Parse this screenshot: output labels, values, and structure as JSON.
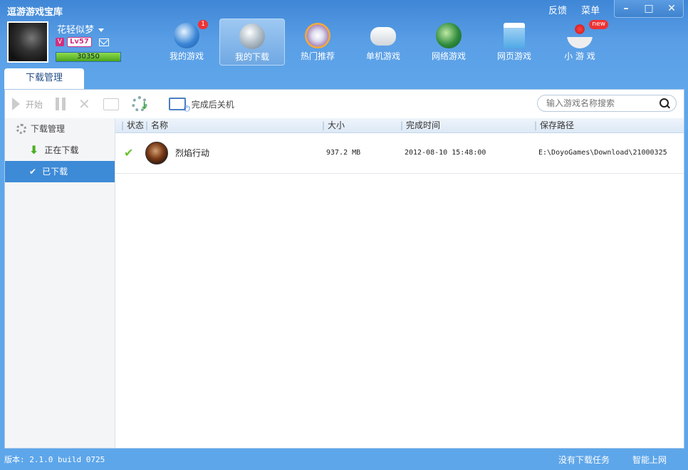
{
  "app": {
    "title": "逗游游戏宝库",
    "feedback": "反馈",
    "menu": "菜单",
    "min": "–",
    "max": "□",
    "close": "✕"
  },
  "user": {
    "name": "花轻似梦",
    "vip": "V",
    "level": "Lv57",
    "exp": "30350"
  },
  "nav": [
    {
      "label": "我的游戏",
      "badge": "1",
      "icon": "people-icon"
    },
    {
      "label": "我的下载",
      "icon": "download-gear-icon",
      "active": true
    },
    {
      "label": "热门推荐",
      "icon": "disc-icon"
    },
    {
      "label": "单机游戏",
      "icon": "gamepad-icon"
    },
    {
      "label": "网络游戏",
      "icon": "globe-sword-icon"
    },
    {
      "label": "网页游戏",
      "icon": "webpage-icon"
    },
    {
      "label": "小 游 戏",
      "badge": "new",
      "icon": "joystick-icon"
    }
  ],
  "tab": {
    "label": "下载管理"
  },
  "toolbar": {
    "start": "开始",
    "shutdown": "完成后关机"
  },
  "search": {
    "placeholder": "输入游戏名称搜索"
  },
  "sidebar": {
    "header": "下载管理",
    "downloading": "正在下载",
    "downloaded": "已下载"
  },
  "table": {
    "headers": {
      "status": "状态",
      "name": "名称",
      "size": "大小",
      "time": "完成时间",
      "path": "保存路径"
    },
    "rows": [
      {
        "status": "✔",
        "name": "烈焰行动",
        "size": "937.2 MB",
        "time": "2012-08-10 15:48:00",
        "path": "E:\\DoyoGames\\Download\\21000325"
      }
    ]
  },
  "status": {
    "version": "版本: 2.1.0 build 0725",
    "tasks": "没有下载任务",
    "net": "智能上网"
  }
}
